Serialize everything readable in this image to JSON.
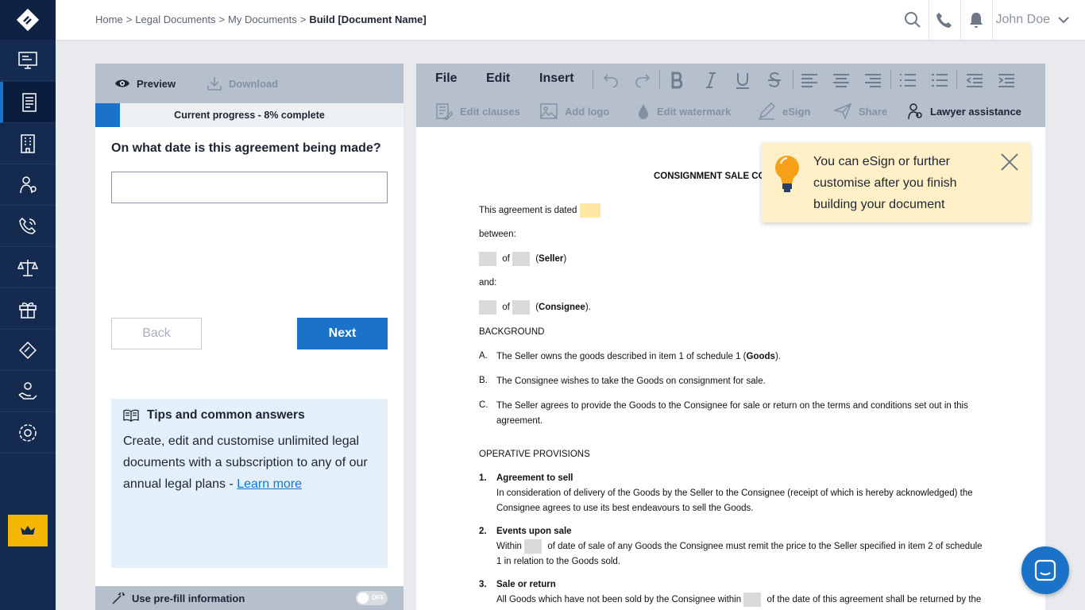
{
  "breadcrumb": {
    "items": [
      "Home",
      "Legal Documents",
      "My Documents"
    ],
    "current": "Build [Document Name]",
    "separator": ">"
  },
  "header": {
    "user_name": "John Doe"
  },
  "left_panel": {
    "preview_label": "Preview",
    "download_label": "Download",
    "progress_text": "Current progress - 8% complete",
    "progress_percent": 8,
    "question": "On what date is this agreement being made?",
    "answer_value": "",
    "back_label": "Back",
    "next_label": "Next",
    "tips": {
      "title": "Tips and common answers",
      "body": "Create, edit and customise unlimited legal documents with a subscription to any of our annual legal plans - ",
      "link": "Learn more"
    },
    "prefill_label": "Use pre-fill information",
    "prefill_toggle": "OFF"
  },
  "editor": {
    "menus": [
      "File",
      "Edit",
      "Insert"
    ],
    "actions": {
      "edit_clauses": "Edit clauses",
      "add_logo": "Add logo",
      "edit_watermark": "Edit watermark",
      "esign": "eSign",
      "share": "Share",
      "lawyer": "Lawyer assistance"
    }
  },
  "tooltip": {
    "text": "You can eSign or further customise after you finish building your document"
  },
  "document": {
    "title": "CONSIGNMENT SALE CO",
    "dated": "This agreement is dated",
    "between": "between:",
    "of": "of",
    "seller": "Seller",
    "and": "and:",
    "consignee": "Consignee",
    "background": "BACKGROUND",
    "a_label": "A.",
    "a_text_pre": "The Seller owns the goods described in item 1 of schedule 1 (",
    "a_text_bold": "Goods",
    "a_text_post": ").",
    "b_label": "B.",
    "b_text": "The Consignee wishes to take the Goods on consignment for sale.",
    "c_label": "C.",
    "c_text_1": "The Seller agrees to provide the Goods to the Consignee for sale or return on the terms and conditions set out in this",
    "c_text_2": "agreement.",
    "operative": "OPERATIVE PROVISIONS",
    "p1_num": "1.",
    "p1_title": "Agreement to sell",
    "p1_text_1": "In consideration of delivery of the Goods by the Seller to the Consignee (receipt of which is hereby acknowledged) the",
    "p1_text_2": "Consignee agrees to use its best endeavours to sell the Goods.",
    "p2_num": "2.",
    "p2_title": "Events upon sale",
    "p2_within": "Within",
    "p2_text_1": "of date of sale of any Goods the Consignee must remit the price to the Seller specified in item 2 of schedule",
    "p2_text_2": "1 in relation to the Goods sold.",
    "p3_num": "3.",
    "p3_title": "Sale or return",
    "p3_text_pre": "All Goods which have not been sold by the Consignee within",
    "p3_text_post": "of the date of this agreement shall be returned by the"
  },
  "colors": {
    "sidebar": "#152a4f",
    "accent": "#1a73c8",
    "toolbar": "#b5c0cc",
    "tooltip": "#fff0c7",
    "crown": "#f5b600"
  }
}
